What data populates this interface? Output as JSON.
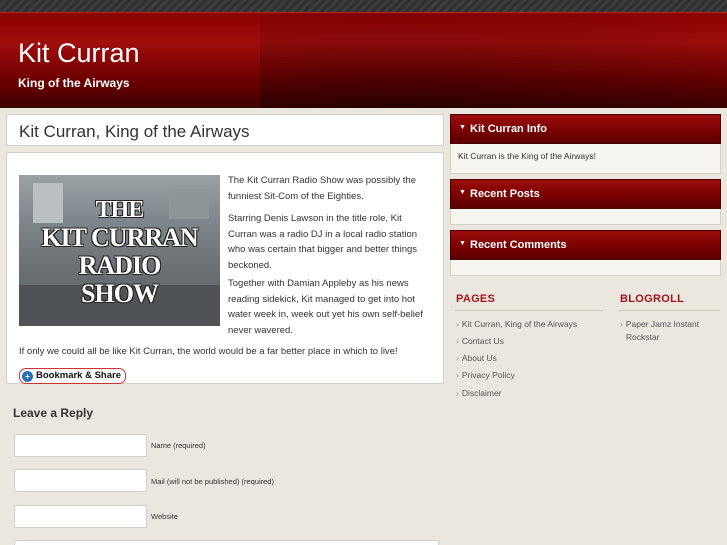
{
  "header": {
    "site_title": "Kit Curran",
    "site_description": "King of the Airways"
  },
  "post": {
    "title": "Kit Curran, King of the Airways",
    "image_text": [
      "THE",
      "KIT CURRAN",
      "RADIO",
      "SHOW"
    ],
    "paragraphs": [
      "The Kit Curran Radio Show was possibly the funniest Sit-Com of the Eighties.",
      "Starring Denis Lawson in the title role, Kit Curran was a radio DJ in a local radio station who was certain that bigger and better things beckoned.",
      "Together with Damian Appleby as his news reading sidekick, Kit managed to get into hot water week in, week out yet his own self-belief never wavered.",
      "If only we could all be like Kit Curran, the world would be a far better place in which to live!"
    ],
    "bookmark_label": "Bookmark & Share"
  },
  "reply": {
    "heading": "Leave a Reply",
    "fields": [
      {
        "label": "Name (required)",
        "value": ""
      },
      {
        "label": "Mail (will not be published) (required)",
        "value": ""
      },
      {
        "label": "Website",
        "value": ""
      }
    ]
  },
  "sidebar": {
    "widgets": [
      {
        "title": "Kit Curran Info",
        "text": "Kit Curran is the King of the Airways!"
      },
      {
        "title": "Recent Posts",
        "text": ""
      },
      {
        "title": "Recent Comments",
        "text": ""
      }
    ],
    "pages": {
      "heading": "PAGES",
      "items": [
        "Kit Curran, King of the Airways",
        "Contact Us",
        "About Us",
        "Privacy Policy",
        "Disclaimer"
      ]
    },
    "blogroll": {
      "heading": "BLOGROLL",
      "items": [
        "Paper Jamz Instant Rockstar"
      ]
    }
  },
  "colors": {
    "header_red": "#8a0000",
    "accent_red": "#a3141c",
    "page_bg": "#ebe7df"
  },
  "icons": {
    "widget_toggle": "triangle-down-icon",
    "list_bullet": "chevron-right-icon",
    "bookmark": "share-icon"
  }
}
